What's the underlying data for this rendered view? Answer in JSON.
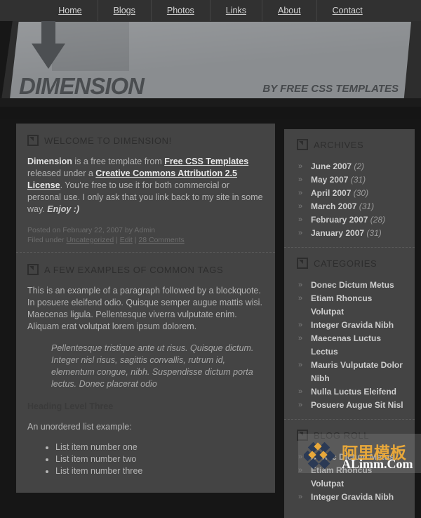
{
  "site": {
    "logo": "DIMENSION",
    "tagline": "BY FREE CSS TEMPLATES"
  },
  "menu": {
    "items": [
      {
        "label": "Home"
      },
      {
        "label": "Blogs"
      },
      {
        "label": "Photos"
      },
      {
        "label": "Links"
      },
      {
        "label": "About"
      },
      {
        "label": "Contact"
      }
    ]
  },
  "posts": [
    {
      "title": "WELCOME TO DIMENSION!",
      "body_lead": "Dimension",
      "body_1": " is a free template from ",
      "link_1": "Free CSS Templates",
      "body_2": " released under a ",
      "link_2": "Creative Commons Attribution 2.5 License",
      "body_3": ". You're free to use it for both commercial or personal use. I only ask that you link back to my site in some way. ",
      "body_em": "Enjoy :)",
      "meta_line1": "Posted on February 22, 2007 by Admin",
      "meta_filed": "Filed under ",
      "meta_cat": "Uncategorized",
      "meta_sep1": " | ",
      "meta_edit": "Edit",
      "meta_sep2": " | ",
      "meta_comments": "28 Comments"
    },
    {
      "title": "A FEW EXAMPLES OF COMMON TAGS",
      "paragraph": "This is an example of a paragraph followed by a blockquote. In posuere eleifend odio. Quisque semper augue mattis wisi. Maecenas ligula. Pellentesque viverra vulputate enim. Aliquam erat volutpat lorem ipsum dolorem.",
      "blockquote": "Pellentesque tristique ante ut risus. Quisque dictum. Integer nisl risus, sagittis convallis, rutrum id, elementum congue, nibh. Suspendisse dictum porta lectus. Donec placerat odio",
      "heading3": "Heading Level Three",
      "list_intro": "An unordered list example:",
      "list_items": [
        "List item number one",
        "List item number two",
        "List item number three"
      ]
    }
  ],
  "sidebar": {
    "archives": {
      "title": "ARCHIVES",
      "items": [
        {
          "label": "June 2007",
          "count": "(2)"
        },
        {
          "label": "May 2007",
          "count": "(31)"
        },
        {
          "label": "April 2007",
          "count": "(30)"
        },
        {
          "label": "March 2007",
          "count": "(31)"
        },
        {
          "label": "February 2007",
          "count": "(28)"
        },
        {
          "label": "January 2007",
          "count": "(31)"
        }
      ]
    },
    "categories": {
      "title": "CATEGORIES",
      "items": [
        {
          "label": "Donec Dictum Metus"
        },
        {
          "label": "Etiam Rhoncus Volutpat"
        },
        {
          "label": "Integer Gravida Nibh"
        },
        {
          "label": "Maecenas Luctus Lectus"
        },
        {
          "label": "Mauris Vulputate Dolor Nibh"
        },
        {
          "label": "Nulla Luctus Eleifend"
        },
        {
          "label": "Posuere Augue Sit Nisl"
        }
      ]
    },
    "blogroll": {
      "title": "BLOG ROLL",
      "items": [
        {
          "label": "Donec Dictum Metus"
        },
        {
          "label": "Etiam Rhoncus Volutpat"
        },
        {
          "label": "Integer Gravida Nibh"
        }
      ]
    },
    "chevron": "»"
  },
  "watermark": {
    "cn": "阿里模板",
    "en": "ALimm.Com"
  },
  "colors": {
    "page_bg": "#161616",
    "box_bg": "#444444",
    "banner": "#8a8d90",
    "menu_bg": "#313131",
    "heading": "#2d2d2d",
    "watermark_accent": "#e8a83a"
  }
}
